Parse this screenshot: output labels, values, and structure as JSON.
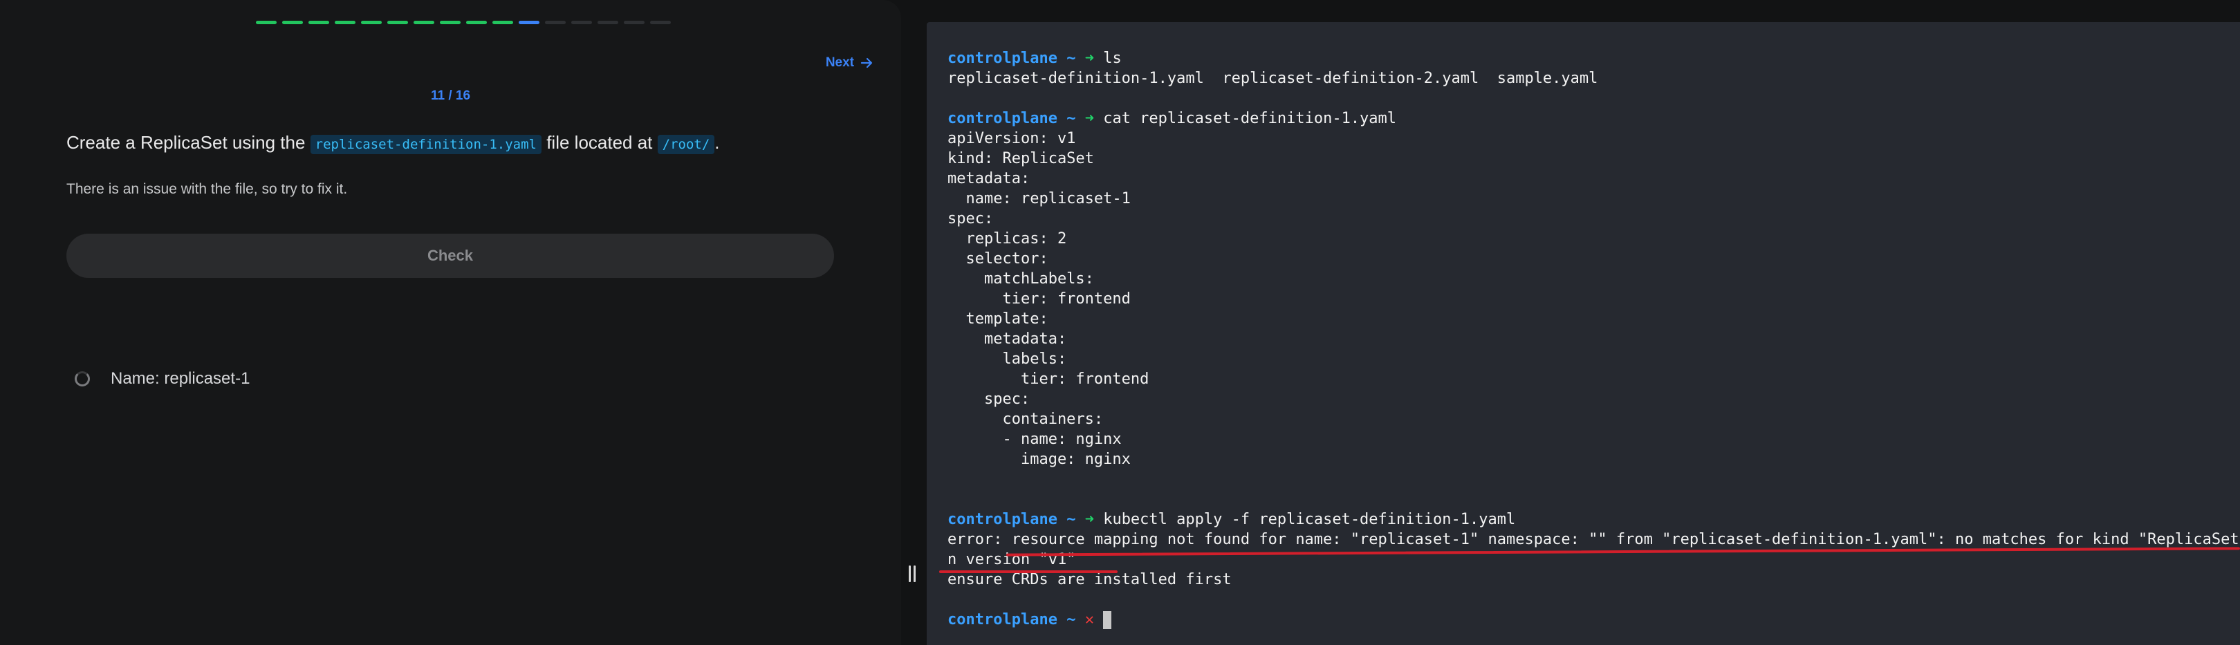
{
  "lab": {
    "progress": {
      "done": 10,
      "current": 11,
      "total": 16
    },
    "next_label": "Next",
    "counter": "11 / 16",
    "question": {
      "prefix": "Create a ReplicaSet using the",
      "file_code": "replicaset-definition-1.yaml",
      "middle": "file located at",
      "path_code": "/root/",
      "suffix": "."
    },
    "hint": "There is an issue with the file, so try to fix it.",
    "check_label": "Check",
    "tasks": [
      {
        "label": "Name: replicaset-1",
        "status": "pending"
      }
    ]
  },
  "terminal": {
    "host": "controlplane",
    "tilde": "~",
    "ok_glyph": "➜",
    "err_glyph": "✕",
    "lines": [
      {
        "type": "prompt",
        "status": "ok",
        "cmd": "ls"
      },
      {
        "type": "out",
        "text": "replicaset-definition-1.yaml  replicaset-definition-2.yaml  sample.yaml"
      },
      {
        "type": "out",
        "text": ""
      },
      {
        "type": "prompt",
        "status": "ok",
        "cmd": "cat replicaset-definition-1.yaml"
      },
      {
        "type": "out",
        "text": "apiVersion: v1"
      },
      {
        "type": "out",
        "text": "kind: ReplicaSet"
      },
      {
        "type": "out",
        "text": "metadata:"
      },
      {
        "type": "out",
        "text": "  name: replicaset-1"
      },
      {
        "type": "out",
        "text": "spec:"
      },
      {
        "type": "out",
        "text": "  replicas: 2"
      },
      {
        "type": "out",
        "text": "  selector:"
      },
      {
        "type": "out",
        "text": "    matchLabels:"
      },
      {
        "type": "out",
        "text": "      tier: frontend"
      },
      {
        "type": "out",
        "text": "  template:"
      },
      {
        "type": "out",
        "text": "    metadata:"
      },
      {
        "type": "out",
        "text": "      labels:"
      },
      {
        "type": "out",
        "text": "        tier: frontend"
      },
      {
        "type": "out",
        "text": "    spec:"
      },
      {
        "type": "out",
        "text": "      containers:"
      },
      {
        "type": "out",
        "text": "      - name: nginx"
      },
      {
        "type": "out",
        "text": "        image: nginx"
      },
      {
        "type": "out",
        "text": ""
      },
      {
        "type": "out",
        "text": ""
      },
      {
        "type": "prompt",
        "status": "ok",
        "cmd": "kubectl apply -f replicaset-definition-1.yaml"
      },
      {
        "type": "out",
        "text": "error: resource mapping not found for name: \"replicaset-1\" namespace: \"\" from \"replicaset-definition-1.yaml\": no matches for kind \"ReplicaSet\" i"
      },
      {
        "type": "out",
        "text": "n version \"v1\""
      },
      {
        "type": "out",
        "text": "ensure CRDs are installed first"
      },
      {
        "type": "out",
        "text": ""
      },
      {
        "type": "prompt",
        "status": "err",
        "cmd": ""
      }
    ]
  },
  "colors": {
    "accent_blue": "#3b82f6",
    "success_green": "#22c55e",
    "error_red": "#ef3b3b",
    "underline_red": "#d21f2b"
  }
}
